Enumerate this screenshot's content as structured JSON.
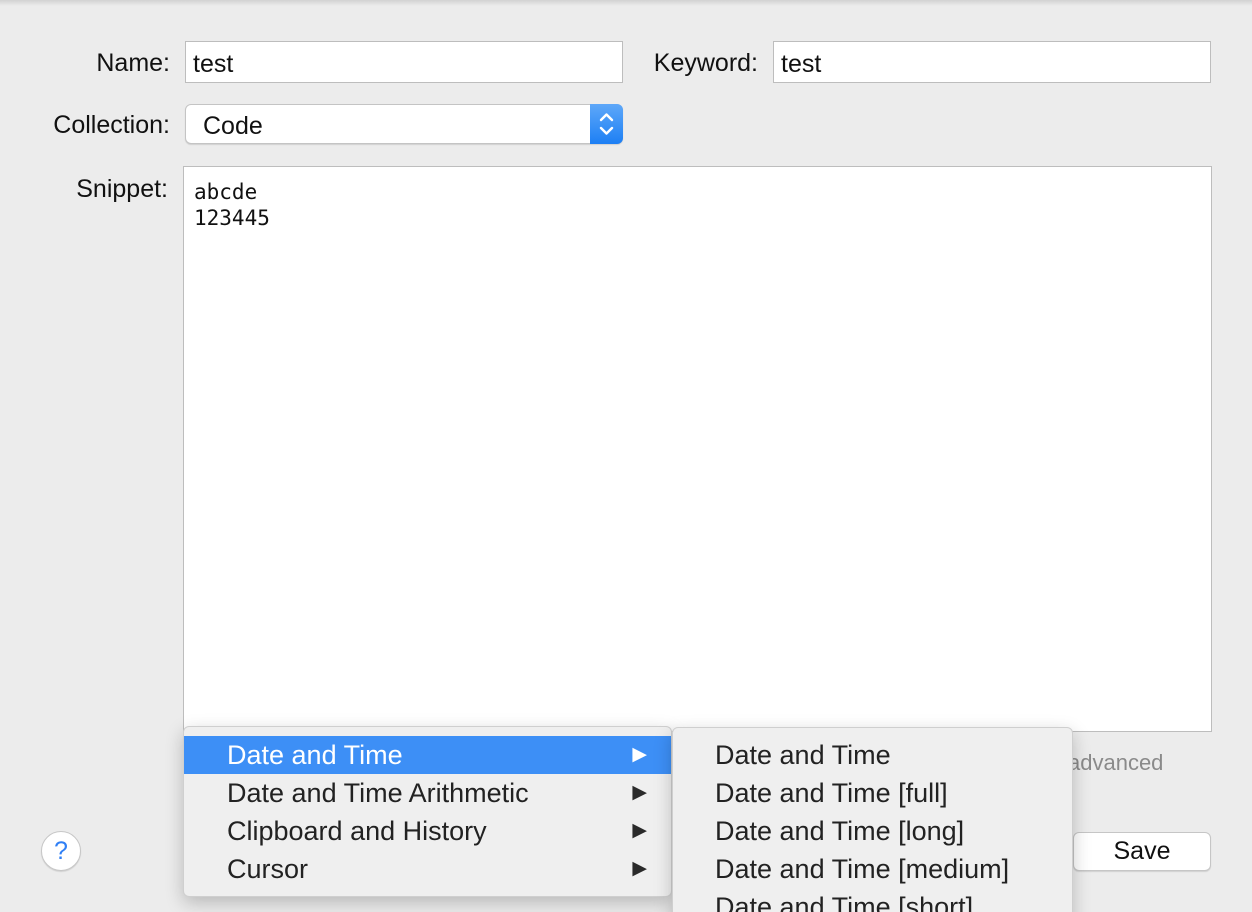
{
  "form": {
    "name_label": "Name:",
    "name_value": "test",
    "keyword_label": "Keyword:",
    "keyword_value": "test",
    "collection_label": "Collection:",
    "collection_value": "Code",
    "snippet_label": "Snippet:",
    "snippet_value": "abcde\n123445"
  },
  "advanced_text": "advanced",
  "buttons": {
    "help_label": "?",
    "save_label": "Save"
  },
  "context_menu": {
    "items": [
      {
        "label": "Date and Time",
        "submenu": "▶",
        "selected": true
      },
      {
        "label": "Date and Time Arithmetic",
        "submenu": "▶",
        "selected": false
      },
      {
        "label": "Clipboard and History",
        "submenu": "▶",
        "selected": false
      },
      {
        "label": "Cursor",
        "submenu": "▶",
        "selected": false
      }
    ],
    "submenu_items": [
      "Date and Time",
      "Date and Time [full]",
      "Date and Time [long]",
      "Date and Time [medium]",
      "Date and Time [short]"
    ]
  },
  "icons": {
    "collection_stepper": "up-down-chevron-icon",
    "submenu_indicator": "triangle-right-icon",
    "help": "question-mark-icon"
  },
  "colors": {
    "accent": "#3d8ff6",
    "window_background": "#ececec",
    "link_gray": "#8a8a8a",
    "help_blue": "#2f7ff5"
  }
}
